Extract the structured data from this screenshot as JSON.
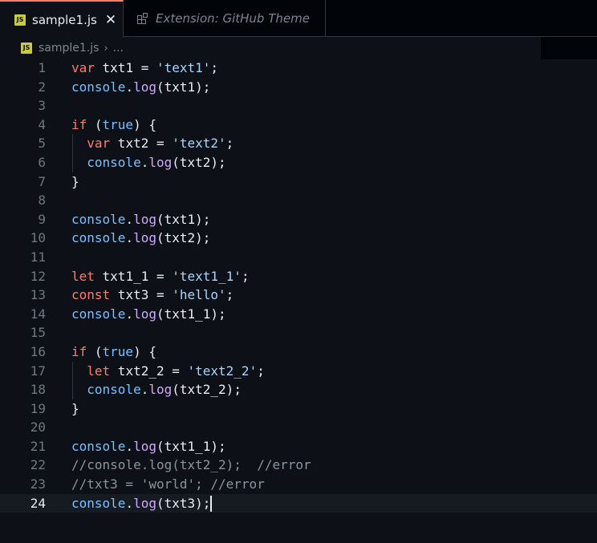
{
  "tabs": [
    {
      "label": "sample1.js",
      "icon": "js-file-icon",
      "active": true
    },
    {
      "label": "Extension: GitHub Theme",
      "icon": "extension-icon",
      "active": false
    }
  ],
  "breadcrumb": {
    "file": "sample1.js",
    "more": "..."
  },
  "editor": {
    "current_line": 24,
    "line_numbers": [
      "1",
      "2",
      "3",
      "4",
      "5",
      "6",
      "7",
      "8",
      "9",
      "10",
      "11",
      "12",
      "13",
      "14",
      "15",
      "16",
      "17",
      "18",
      "19",
      "20",
      "21",
      "22",
      "23",
      "24"
    ],
    "lines": [
      "var txt1 = 'text1';",
      "console.log(txt1);",
      "",
      "if (true) {",
      "  var txt2 = 'text2';",
      "  console.log(txt2);",
      "}",
      "",
      "console.log(txt1);",
      "console.log(txt2);",
      "",
      "let txt1_1 = 'text1_1';",
      "const txt3 = 'hello';",
      "console.log(txt1_1);",
      "",
      "if (true) {",
      "  let txt2_2 = 'text2_2';",
      "  console.log(txt2_2);",
      "}",
      "",
      "console.log(txt1_1);",
      "//console.log(txt2_2);  //error",
      "//txt3 = 'world'; //error",
      "console.log(txt3);"
    ]
  },
  "theme": {
    "background": "#0d1117",
    "keyword": "#ff7b72",
    "string": "#a5d6ff",
    "function": "#d2a8ff",
    "object": "#79c0ff",
    "comment": "#8b949e",
    "tab_accent": "#f78166"
  }
}
